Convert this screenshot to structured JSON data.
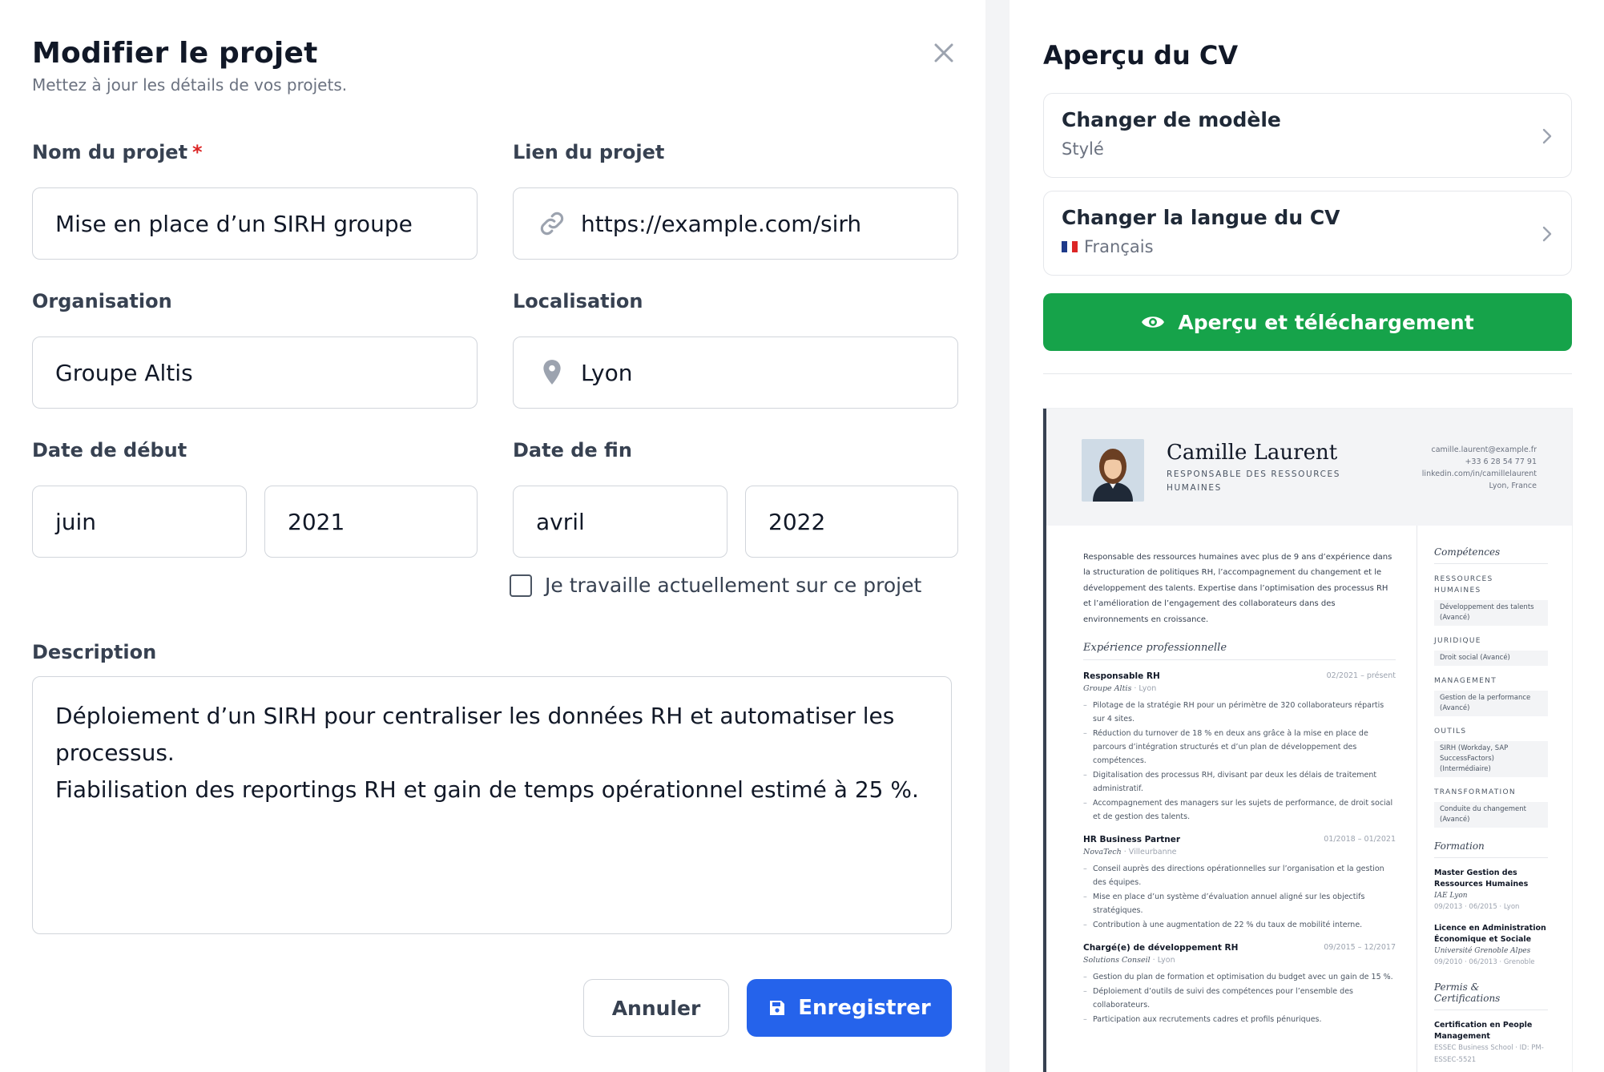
{
  "editor": {
    "title": "Modifier le projet",
    "subtitle": "Mettez à jour les détails de vos projets.",
    "close_label": "Fermer",
    "fields": {
      "name_label": "Nom du projet",
      "name_required": "*",
      "name_value": "Mise en place d’un SIRH groupe",
      "link_label": "Lien du projet",
      "link_value": "https://example.com/sirh",
      "org_label": "Organisation",
      "org_value": "Groupe Altis",
      "location_label": "Localisation",
      "location_value": "Lyon",
      "start_label": "Date de début",
      "start_month": "juin",
      "start_year": "2021",
      "end_label": "Date de fin",
      "end_month": "avril",
      "end_year": "2022",
      "current_label": "Je travaille actuellement sur ce projet",
      "current_checked": false,
      "description_label": "Description",
      "description_lines": [
        "Déploiement d’un SIRH pour centraliser les données RH et automatiser les",
        "processus.",
        "Fiabilisation des reportings RH et gain de temps opérationnel estimé à 25 %."
      ]
    },
    "buttons": {
      "cancel": "Annuler",
      "save": "Enregistrer"
    }
  },
  "preview": {
    "title": "Aperçu du CV",
    "template_card": {
      "title": "Changer de modèle",
      "value": "Stylé"
    },
    "language_card": {
      "title": "Changer la langue du CV",
      "value": "Français"
    },
    "download_button": "Aperçu et téléchargement"
  },
  "cv": {
    "name": "Camille Laurent",
    "role_line1": "RESPONSABLE DES RESSOURCES",
    "role_line2": "HUMAINES",
    "contact": {
      "email": "camille.laurent@example.fr",
      "phone": "+33 6 28 54 77 91",
      "linkedin": "linkedin.com/in/camillelaurent",
      "city": "Lyon, France"
    },
    "summary": "Responsable des ressources humaines avec plus de 9 ans d’expérience dans la structuration de politiques RH, l’accompagnement du changement et le développement des talents. Expertise dans l’optimisation des processus RH et l’amélioration de l’engagement des collaborateurs dans des environnements en croissance.",
    "experience_heading": "Expérience professionnelle",
    "jobs": [
      {
        "title": "Responsable RH",
        "dates": "02/2021 – présent",
        "org": "Groupe Altis",
        "loc": "Lyon",
        "bullets": [
          "Pilotage de la stratégie RH pour un périmètre de 320 collaborateurs répartis sur 4 sites.",
          "Réduction du turnover de 18 % en deux ans grâce à la mise en place de parcours d’intégration structurés et d’un plan de développement des compétences.",
          "Digitalisation des processus RH, divisant par deux les délais de traitement administratif.",
          "Accompagnement des managers sur les sujets de performance, de droit social et de gestion des talents."
        ]
      },
      {
        "title": "HR Business Partner",
        "dates": "01/2018 – 01/2021",
        "org": "NovaTech",
        "loc": "Villeurbanne",
        "bullets": [
          "Conseil auprès des directions opérationnelles sur l’organisation et la gestion des équipes.",
          "Mise en place d’un système d’évaluation annuel aligné sur les objectifs stratégiques.",
          "Contribution à une augmentation de 22 % du taux de mobilité interne."
        ]
      },
      {
        "title": "Chargé(e) de développement RH",
        "dates": "09/2015 – 12/2017",
        "org": "Solutions Conseil",
        "loc": "Lyon",
        "bullets": [
          "Gestion du plan de formation et optimisation du budget avec un gain de 15 %.",
          "Déploiement d’outils de suivi des compétences pour l’ensemble des collaborateurs.",
          "Participation aux recrutements cadres et profils pénuriques."
        ]
      }
    ],
    "skills_heading": "Compétences",
    "skills": [
      {
        "cat_line1": "RESSOURCES",
        "cat_line2": "HUMAINES",
        "tags": [
          "Développement des talents (Avancé)"
        ]
      },
      {
        "cat_line1": "JURIDIQUE",
        "cat_line2": "",
        "tags": [
          "Droit social (Avancé)"
        ]
      },
      {
        "cat_line1": "MANAGEMENT",
        "cat_line2": "",
        "tags": [
          "Gestion de la performance (Avancé)"
        ]
      },
      {
        "cat_line1": "OUTILS",
        "cat_line2": "",
        "tags": [
          "SIRH (Workday, SAP SuccessFactors) (Intermédiaire)"
        ]
      },
      {
        "cat_line1": "TRANSFORMATION",
        "cat_line2": "",
        "tags": [
          "Conduite du changement (Avancé)"
        ]
      }
    ],
    "education_heading": "Formation",
    "education": [
      {
        "degree": "Master Gestion des Ressources Humaines",
        "school": "IAE Lyon",
        "dates": "09/2013 · 06/2015 · Lyon"
      },
      {
        "degree": "Licence en Administration Économique et Sociale",
        "school": "Université Grenoble Alpes",
        "dates": "09/2010 · 06/2013 · Grenoble"
      }
    ],
    "certs_heading": "Permis & Certifications",
    "certs": [
      {
        "name": "Certification en People Management",
        "issuer": "ESSEC Business School · ID: PM-ESSEC-5521"
      }
    ]
  },
  "colors": {
    "primary": "#2563eb",
    "success": "#16a34a",
    "required": "#dc2626"
  },
  "icons": [
    "close-icon",
    "link-icon",
    "map-pin-icon",
    "save-icon",
    "chevron-right-icon",
    "eye-icon",
    "flag-fr-icon"
  ]
}
